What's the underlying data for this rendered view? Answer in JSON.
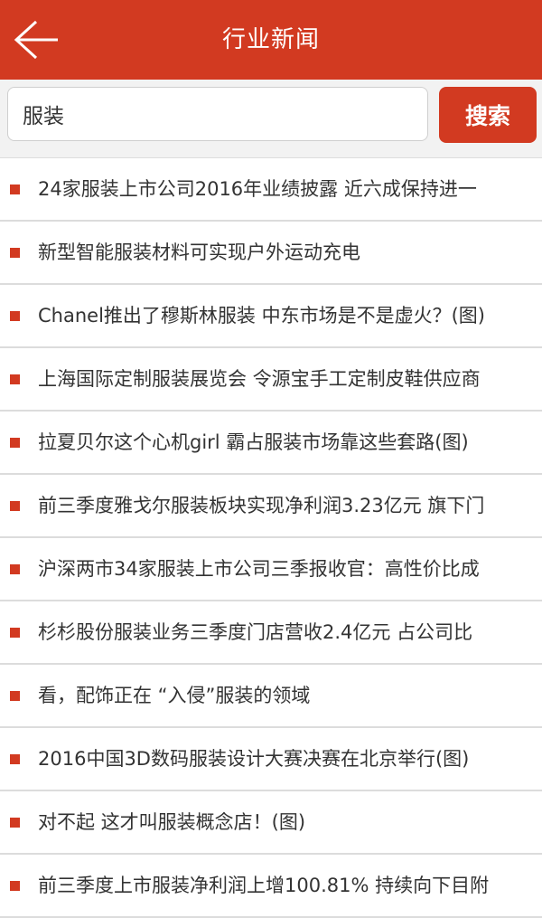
{
  "header": {
    "title": "行业新闻"
  },
  "search": {
    "value": "服装",
    "button_label": "搜索"
  },
  "news": [
    "24家服装上市公司2016年业绩披露 近六成保持进一",
    "新型智能服装材料可实现户外运动充电",
    "Chanel推出了穆斯林服装 中东市场是不是虚火？(图)",
    "上海国际定制服装展览会 令源宝手工定制皮鞋供应商",
    "拉夏贝尔这个心机girl 霸占服装市场靠这些套路(图)",
    "前三季度雅戈尔服装板块实现净利润3.23亿元 旗下门",
    "沪深两市34家服装上市公司三季报收官：高性价比成",
    "杉杉股份服装业务三季度门店营收2.4亿元 占公司比",
    "看，配饰正在 “入侵”服装的领域",
    "2016中国3D数码服装设计大赛决赛在北京举行(图)",
    "对不起 这才叫服装概念店！(图)",
    "前三季度上市服装净利润上增100.81% 持续向下目附"
  ],
  "colors": {
    "accent": "#d23a21",
    "divider": "#dcdcdc"
  },
  "icons": {
    "back": "arrow-left-icon",
    "bullet": "square-bullet-icon"
  }
}
